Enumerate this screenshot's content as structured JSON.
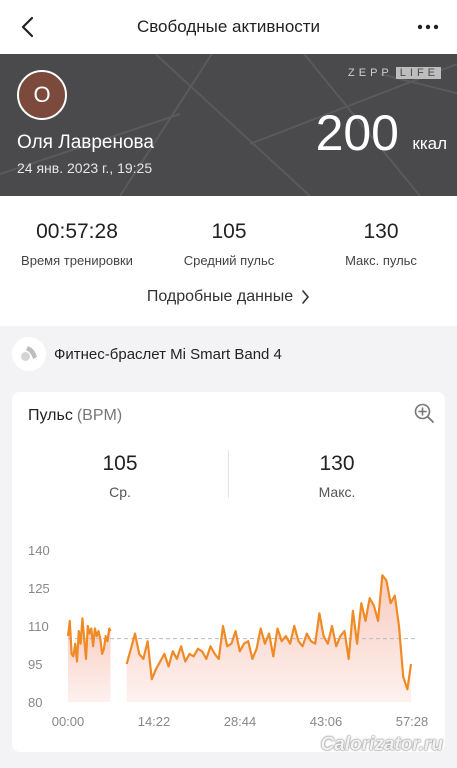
{
  "header": {
    "title": "Свободные активности",
    "back_icon": "chevron-left-icon",
    "more_icon": "more-dots-icon"
  },
  "hero": {
    "avatar_initial": "О",
    "avatar_color": "#7b4a3c",
    "user_name": "Оля Лавренова",
    "date": "24 янв. 2023 г., 19:25",
    "logo_left": "ZEPP",
    "logo_right": "LIFE",
    "calories_value": "200",
    "calories_unit": "ккал",
    "background_color": "#4a4a4c"
  },
  "stats": [
    {
      "value": "00:57:28",
      "label": "Время тренировки"
    },
    {
      "value": "105",
      "label": "Средний пульс"
    },
    {
      "value": "130",
      "label": "Макс. пульс"
    }
  ],
  "details_link": "Подробные данные",
  "device": {
    "name": "Фитнес-браслет Mi Smart Band 4",
    "icon": "fitness-band-icon"
  },
  "pulse_card": {
    "title": "Пульс",
    "unit": "(BPM)",
    "zoom_icon": "zoom-in-icon",
    "avg_value": "105",
    "avg_label": "Ср.",
    "max_value": "130",
    "max_label": "Макс."
  },
  "chart_data": {
    "type": "area",
    "title": "",
    "xlabel": "",
    "ylabel": "",
    "line_color": "#f08a24",
    "fill_color": "#f8c9bd",
    "y_ticks": [
      "140",
      "125",
      "110",
      "95",
      "80"
    ],
    "x_ticks": [
      "00:00",
      "14:22",
      "28:44",
      "43:06",
      "57:28"
    ],
    "ylim": [
      80,
      140
    ],
    "xlim": [
      0,
      57.47
    ],
    "average_line": 105,
    "segments": [
      {
        "x": [
          0.0,
          0.3,
          0.6,
          0.9,
          1.2,
          1.5,
          1.8,
          2.1,
          2.4,
          2.7,
          3.0,
          3.3,
          3.6,
          3.9,
          4.2,
          4.5,
          4.8,
          5.1,
          5.4,
          5.7,
          6.0,
          6.3,
          6.6,
          6.9,
          7.1
        ],
        "y": [
          106,
          112,
          99,
          98,
          103,
          96,
          108,
          103,
          113,
          105,
          97,
          110,
          107,
          109,
          102,
          109,
          106,
          108,
          105,
          99,
          101,
          106,
          104,
          109,
          108
        ]
      },
      {
        "x": [
          9.8,
          10.5,
          11.2,
          11.9,
          12.6,
          13.3,
          14.0,
          14.7,
          15.4,
          16.1,
          16.8,
          17.5,
          18.2,
          18.9,
          19.6,
          20.3,
          21.0,
          21.7,
          22.4,
          23.1,
          23.8,
          24.5,
          25.2,
          25.9,
          26.6,
          27.3,
          28.0,
          28.7,
          29.4,
          30.1,
          30.8,
          31.5,
          32.2,
          32.9,
          33.6,
          34.3,
          35.0,
          35.7,
          36.4,
          37.1,
          37.8,
          38.5,
          39.2,
          39.9,
          40.6,
          41.3,
          42.0,
          42.7,
          43.4,
          44.1,
          44.8,
          45.5,
          46.2,
          46.9,
          47.6,
          48.3,
          49.0,
          49.7,
          50.4,
          51.1,
          51.8,
          52.5,
          53.2,
          53.9,
          54.6,
          55.3,
          56.0,
          56.7,
          57.3
        ],
        "y": [
          95,
          101,
          107,
          99,
          97,
          104,
          89,
          93,
          96,
          99,
          94,
          100,
          97,
          102,
          96,
          99,
          98,
          101,
          100,
          97,
          102,
          99,
          97,
          110,
          102,
          103,
          108,
          100,
          103,
          104,
          97,
          101,
          109,
          103,
          107,
          98,
          109,
          104,
          106,
          103,
          110,
          104,
          102,
          107,
          104,
          103,
          115,
          106,
          103,
          110,
          102,
          106,
          108,
          97,
          116,
          103,
          119,
          112,
          121,
          118,
          112,
          130,
          128,
          119,
          122,
          110,
          90,
          85,
          95
        ]
      }
    ]
  }
}
